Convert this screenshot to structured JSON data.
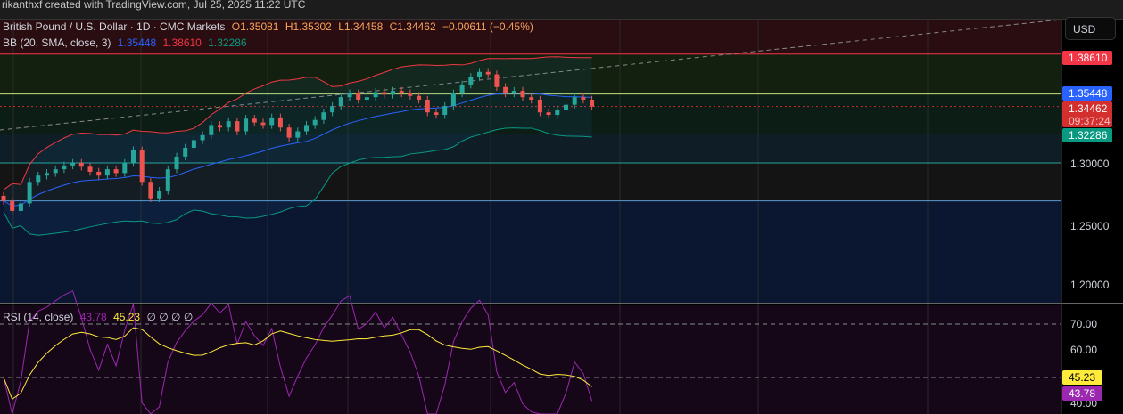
{
  "topbar": {
    "text": "rikanthxf created with TradingView.com, Jul 25, 2025 11:22 UTC"
  },
  "legend": {
    "symbol": "British Pound / U.S. Dollar · 1D · CMC Markets",
    "open": "O1.35081",
    "high": "H1.35302",
    "low": "L1.34458",
    "close": "C1.34462",
    "change": "−0.00611 (−0.45%)",
    "bb_label": "BB (20, SMA, close, 3)",
    "bb_basis": "1.35448",
    "bb_upper": "1.38610",
    "bb_lower": "1.32286",
    "rsi_label": "RSI (14, close)",
    "rsi_value": "43.78",
    "rsi_ma": "45.23",
    "rsi_extra": "∅  ∅  ∅  ∅"
  },
  "price_axis": {
    "currency": "USD",
    "ticks": [
      "1.30000",
      "1.25000",
      "1.20000"
    ],
    "tags": {
      "upper": "1.38610",
      "basis": "1.35448",
      "last": "1.34462",
      "countdown": "09:37:24",
      "lower": "1.32286"
    }
  },
  "rsi_axis": {
    "ticks": [
      "70.00",
      "60.00",
      "40.00"
    ],
    "tags": {
      "ma": "45.23",
      "rsi": "43.78"
    }
  },
  "colors": {
    "up": "#26a69a",
    "down": "#ef5350",
    "bb_basis": "#2962ff",
    "bb_upper": "#f23645",
    "bb_lower": "#089981",
    "rsi": "#9c27b0",
    "rsi_ma": "#ffeb3b"
  },
  "chart_data": {
    "type": "candlestick",
    "title": "British Pound / U.S. Dollar · 1D · CMC Markets",
    "ylim": [
      1.18,
      1.42
    ],
    "closes": [
      1.27,
      1.262,
      1.268,
      1.285,
      1.29,
      1.292,
      1.295,
      1.298,
      1.3,
      1.297,
      1.293,
      1.29,
      1.295,
      1.292,
      1.3,
      1.31,
      1.285,
      1.272,
      1.278,
      1.295,
      1.305,
      1.312,
      1.318,
      1.322,
      1.33,
      1.328,
      1.333,
      1.325,
      1.335,
      1.332,
      1.33,
      1.336,
      1.328,
      1.32,
      1.325,
      1.33,
      1.334,
      1.34,
      1.345,
      1.352,
      1.355,
      1.35,
      1.352,
      1.356,
      1.354,
      1.357,
      1.355,
      1.353,
      1.35,
      1.34,
      1.338,
      1.345,
      1.355,
      1.362,
      1.368,
      1.372,
      1.37,
      1.36,
      1.355,
      1.357,
      1.352,
      1.35,
      1.34,
      1.338,
      1.342,
      1.346,
      1.352,
      1.35,
      1.3446
    ],
    "last": {
      "open": 1.35081,
      "high": 1.35302,
      "low": 1.34458,
      "close": 1.34462
    },
    "levels": [
      1.3861,
      1.35448,
      1.32286,
      1.3,
      1.27
    ],
    "rsi_ylim": [
      35,
      80
    ],
    "rsi_levels": [
      70,
      50
    ]
  }
}
